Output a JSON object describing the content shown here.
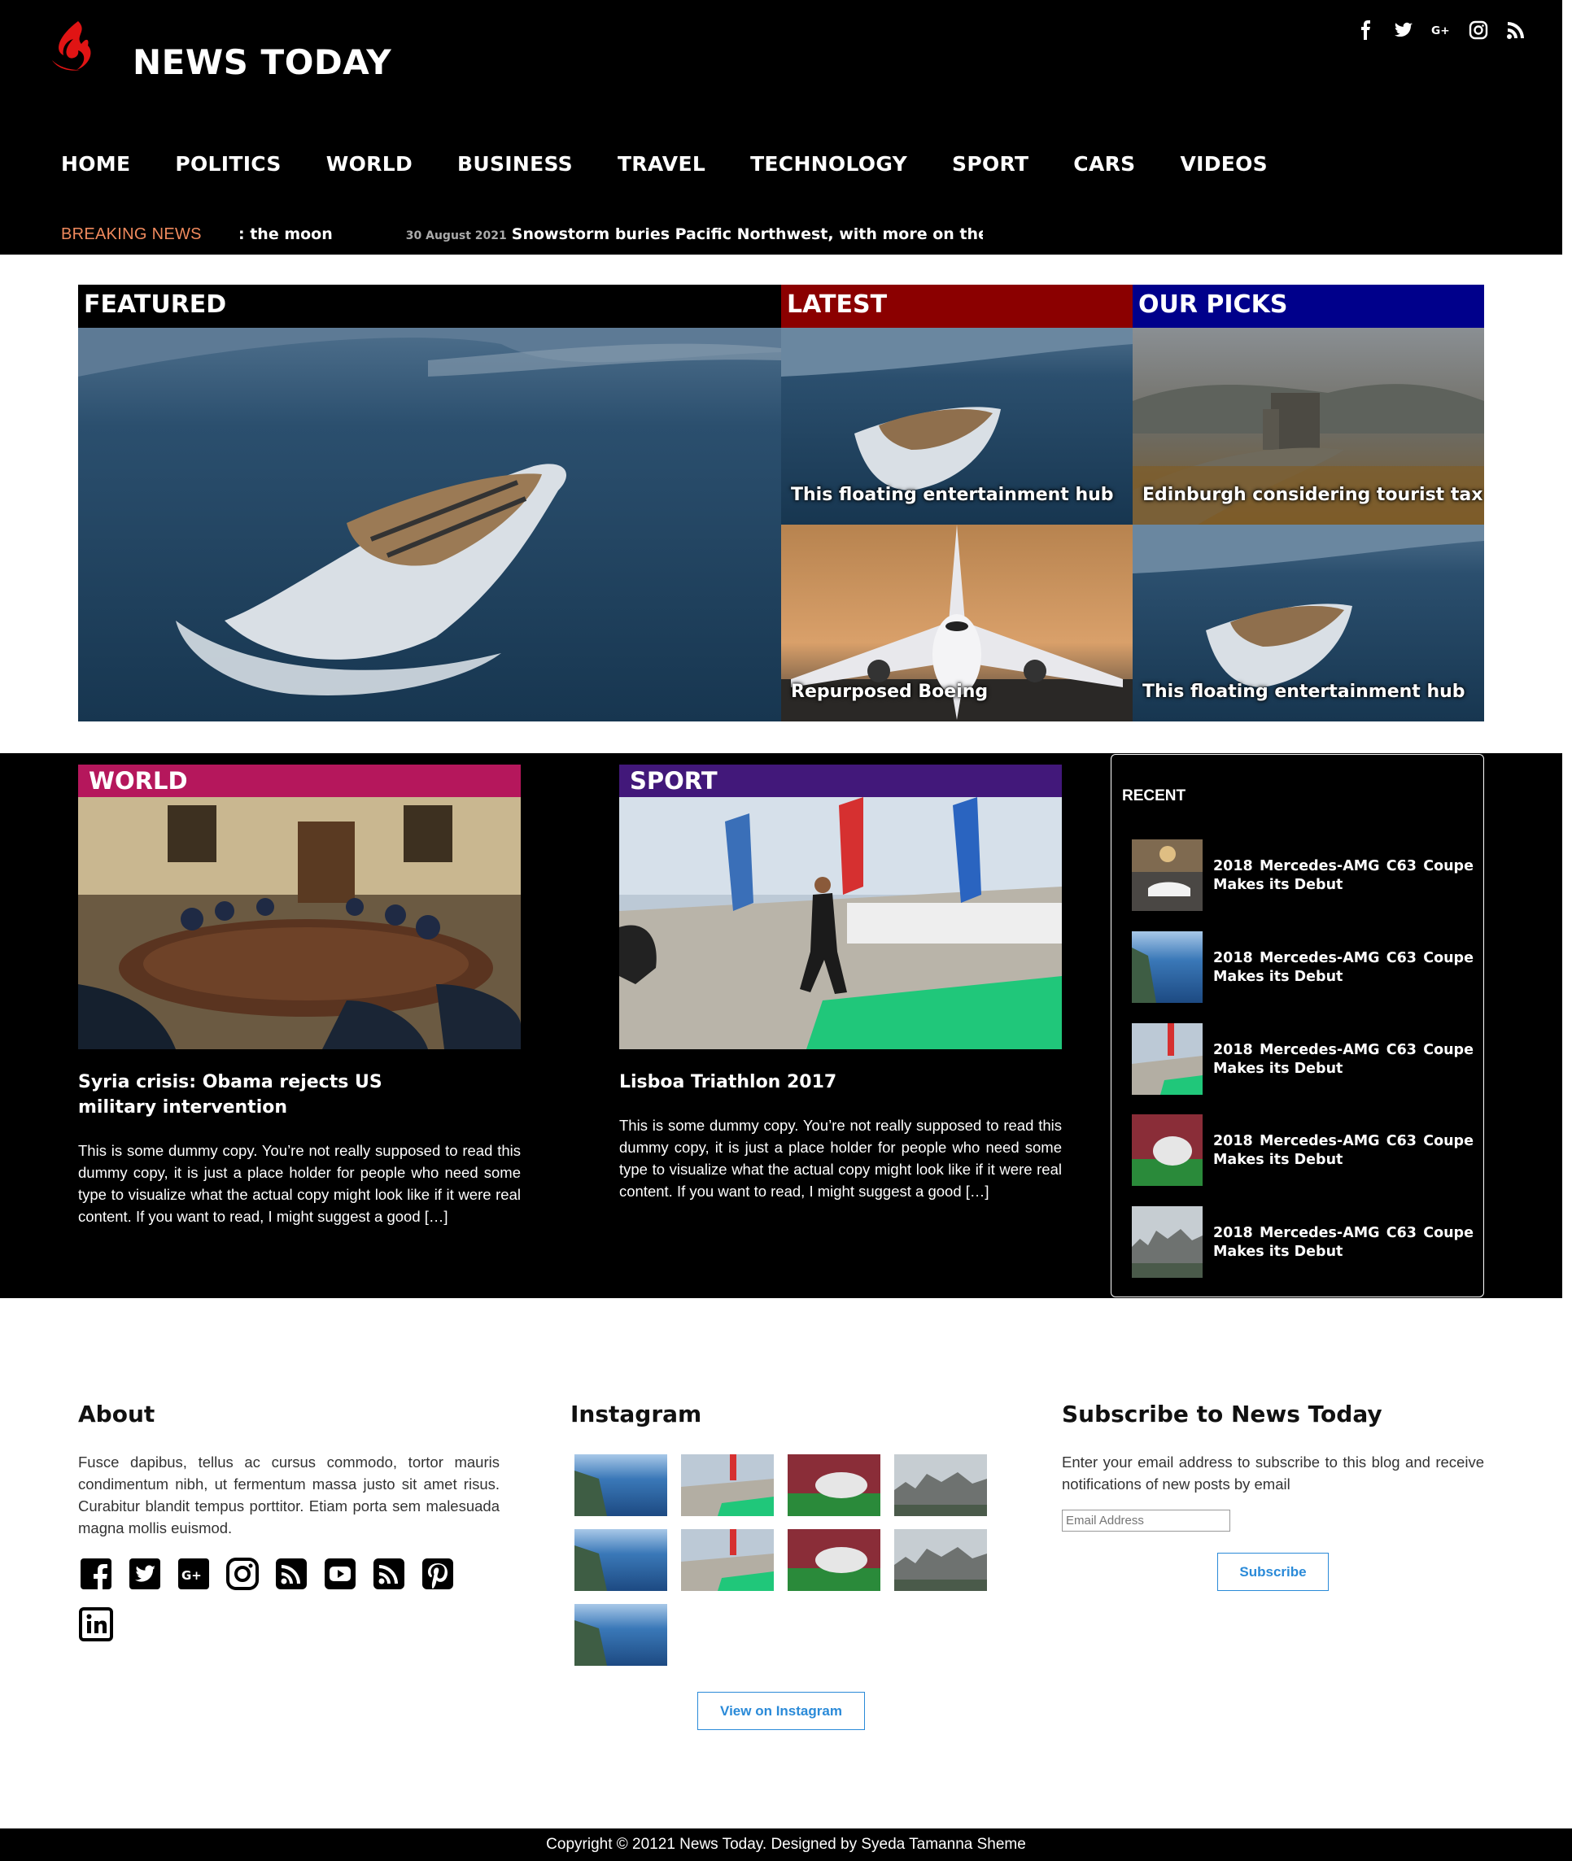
{
  "site": {
    "title": "NEWS TODAY"
  },
  "header": {
    "social": [
      "facebook-icon",
      "twitter-icon",
      "google-plus-icon",
      "instagram-icon",
      "rss-icon"
    ],
    "nav": [
      "HOME",
      "POLITICS",
      "WORLD",
      "BUSINESS",
      "TRAVEL",
      "TECHNOLOGY",
      "SPORT",
      "CARS",
      "VIDEOS"
    ],
    "breaking_label": "BREAKING NEWS",
    "ticker": {
      "lead": ": the moon",
      "date": "30 August 2021",
      "headline": "Snowstorm buries Pacific Northwest, with more on the way"
    }
  },
  "featured": {
    "featured_label": "FEATURED",
    "latest_label": "LATEST",
    "picks_label": "OUR PICKS",
    "latest_items": [
      "This floating entertainment hub",
      "Repurposed Boeing"
    ],
    "picks_items": [
      "Edinburgh considering tourist tax",
      "This floating entertainment hub"
    ]
  },
  "colors": {
    "latest": "#8b0000",
    "picks": "#00008b",
    "world": "#b5175c",
    "sport": "#42187a",
    "accent": "#ee1111",
    "breaking": "#f08a5d",
    "button": "#2a8ad8"
  },
  "categories": [
    {
      "label": "WORLD",
      "title": "Syria crisis: Obama rejects US military intervention",
      "excerpt": "This is some dummy copy. You’re not really supposed to read this dummy copy, it is just a place holder for people who need some type to visualize what the actual copy might look like if it were real content. If you want to read, I might suggest a good […]"
    },
    {
      "label": "SPORT",
      "title": "Lisboa Triathlon 2017",
      "excerpt": "This is some dummy copy. You’re not really supposed to read this dummy copy, it is just a place holder for people who need some type to visualize what the actual copy might look like if it were real content. If you want to read, I might suggest a good […]"
    }
  ],
  "recent": {
    "title": "RECENT",
    "items": [
      {
        "line1": [
          "2018",
          "Mercedes-AMG",
          "C63",
          "Coupe"
        ],
        "line2": "Makes its Debut"
      },
      {
        "line1": [
          "2018",
          "Mercedes-AMG",
          "C63",
          "Coupe"
        ],
        "line2": "Makes its Debut"
      },
      {
        "line1": [
          "2018",
          "Mercedes-AMG",
          "C63",
          "Coupe"
        ],
        "line2": "Makes its Debut"
      },
      {
        "line1": [
          "2018",
          "Mercedes-AMG",
          "C63",
          "Coupe"
        ],
        "line2": "Makes its Debut"
      },
      {
        "line1": [
          "2018",
          "Mercedes-AMG",
          "C63",
          "Coupe"
        ],
        "line2": "Makes its Debut"
      }
    ]
  },
  "about": {
    "title": "About",
    "text": "Fusce dapibus, tellus ac cursus commodo, tortor mauris condimentum nibh, ut fermentum massa justo sit amet risus. Curabitur blandit tempus porttitor. Etiam porta sem malesuada magna mollis euismod.",
    "icons": [
      "facebook-icon",
      "twitter-icon",
      "google-plus-icon",
      "instagram-icon",
      "rss-icon",
      "youtube-icon",
      "rss-icon",
      "pinterest-icon",
      "linkedin-icon"
    ]
  },
  "instagram": {
    "title": "Instagram",
    "button": "View on Instagram"
  },
  "subscribe": {
    "title": "Subscribe to News Today",
    "text": "Enter your email address to subscribe to this blog and receive notifications of new posts by email",
    "placeholder": "Email Address",
    "button": "Subscribe"
  },
  "footer": {
    "copyright": "Copyright © 20121 News Today. Designed by Syeda Tamanna Sheme"
  }
}
